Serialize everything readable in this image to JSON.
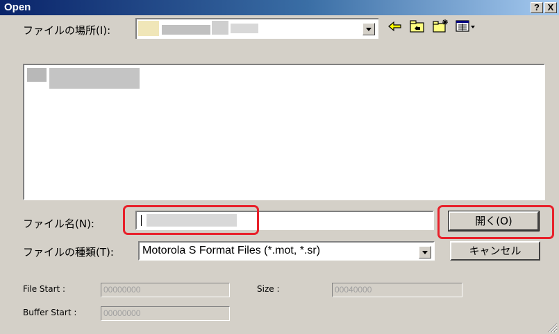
{
  "window": {
    "title": "Open",
    "help_label": "?",
    "close_label": "X"
  },
  "location": {
    "label": "ファイルの場所(I):"
  },
  "toolbar": {
    "icons": [
      "back-arrow-icon",
      "up-folder-icon",
      "new-folder-icon",
      "view-menu-icon"
    ]
  },
  "filename": {
    "label": "ファイル名(N):",
    "value": ""
  },
  "filetype": {
    "label": "ファイルの種類(T):",
    "value": "Motorola S Format Files (*.mot, *.sr)"
  },
  "buttons": {
    "open": "開く(O)",
    "cancel": "キャンセル"
  },
  "info": {
    "file_start_label": "File Start :",
    "file_start_value": "00000000",
    "size_label": "Size :",
    "size_value": "00040000",
    "buffer_start_label": "Buffer Start :",
    "buffer_start_value": "00000000"
  },
  "colors": {
    "titlebar_start": "#0a246a",
    "titlebar_end": "#a6caf0",
    "highlight": "#e8202a",
    "face": "#d4d0c8"
  }
}
